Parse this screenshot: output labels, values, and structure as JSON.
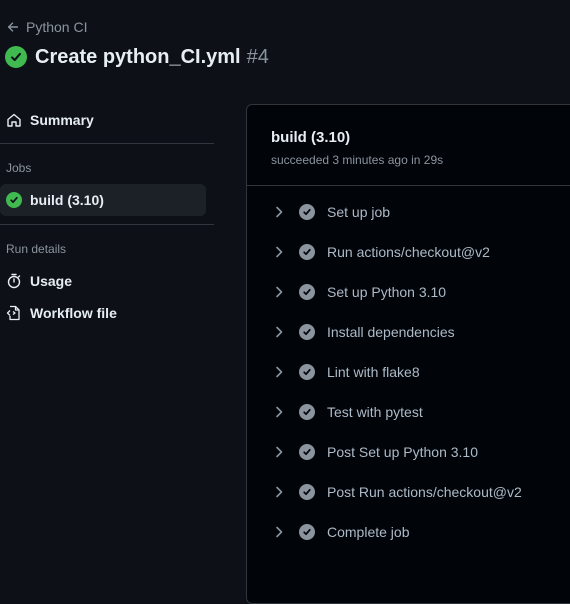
{
  "header": {
    "back_label": "Python CI",
    "title": "Create python_CI.yml",
    "run_number": "#4"
  },
  "sidebar": {
    "summary_label": "Summary",
    "jobs_heading": "Jobs",
    "jobs": [
      {
        "label": "build (3.10)"
      }
    ],
    "run_details_heading": "Run details",
    "usage_label": "Usage",
    "workflow_file_label": "Workflow file"
  },
  "job_panel": {
    "title": "build (3.10)",
    "subtitle": "succeeded 3 minutes ago in 29s",
    "steps": [
      {
        "label": "Set up job"
      },
      {
        "label": "Run actions/checkout@v2"
      },
      {
        "label": "Set up Python 3.10"
      },
      {
        "label": "Install dependencies"
      },
      {
        "label": "Lint with flake8"
      },
      {
        "label": "Test with pytest"
      },
      {
        "label": "Post Set up Python 3.10"
      },
      {
        "label": "Post Run actions/checkout@v2"
      },
      {
        "label": "Complete job"
      }
    ]
  },
  "colors": {
    "success": "#3fb950",
    "step_check": "#8b949e",
    "background": "#0d1117",
    "panel_background": "#010409"
  },
  "icons": [
    "arrow-left-icon",
    "check-circle-icon",
    "home-icon",
    "stopwatch-icon",
    "workflow-file-icon",
    "chevron-right-icon"
  ]
}
